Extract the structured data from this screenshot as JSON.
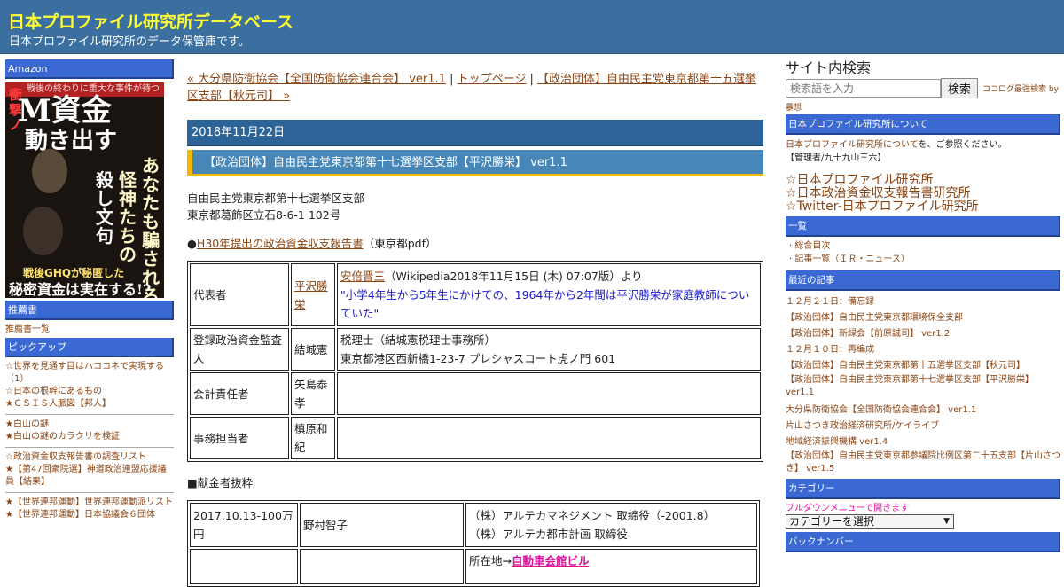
{
  "header": {
    "title": "日本プロファイル研究所データベース",
    "description": "日本プロファイル研究所のデータ保管庫です。"
  },
  "left_sidebar": {
    "amazon_label": "Amazon",
    "book": {
      "header": "戦後の終わりに重大な事件が待つ",
      "side": "衝撃ノ",
      "title_line1": "M資金",
      "title_line2": "動き出す",
      "vertical1": "あなたも騙される",
      "vertical2": "怪神たちの",
      "vertical3": "殺し文句",
      "bottom1": "戦後GHQが秘匿した",
      "bottom2": "秘密資金は実在する!?"
    },
    "recommend_label": "推薦書",
    "recommend_link": "推薦書一覧",
    "pickup_label": "ピックアップ",
    "pickup_groups": [
      [
        "☆世界を見通す目はハココネで実現する（1）",
        "☆日本の根幹にあるもの",
        "★ＣＳＩＳ人脈図【邦人】"
      ],
      [
        "★白山の謎",
        "★白山の謎のカラクリを検証"
      ],
      [
        "☆政治資金収支報告書の調査リスト",
        "★【第47回衆院選】神道政治連盟応援議員【結果】"
      ],
      [
        "★【世界連邦運動】世界連邦運動派リスト",
        "★【世界連邦運動】日本協議会６団体"
      ]
    ]
  },
  "main": {
    "nav": {
      "prev": "« 大分県防衛協会【全国防衛協会連合会】 ver1.1",
      "sep1": " | ",
      "top": "トップページ",
      "sep2": " | ",
      "next": "【政治団体】自由民主党東京都第十五選挙区支部【秋元司】 »"
    },
    "date": "2018年11月22日",
    "post_title": "【政治団体】自由民主党東京都第十七選挙区支部【平沢勝栄】 ver1.1",
    "org_name": "自由民主党東京都第十七選挙区支部",
    "org_address": "東京都葛飾区立石8-6-1 102号",
    "pdf_bullet": "●",
    "pdf_link": "H30年提出の政治資金収支報告書",
    "pdf_suffix": "（東京都pdf）",
    "officers": {
      "rep_label": "代表者",
      "rep_name": "平沢勝栄",
      "rep_wiki_link": "安倍晋三",
      "rep_wiki_suffix": "（Wikipedia2018年11月15日 (木) 07:07版）より",
      "rep_quote": "\"小学4年生から5年生にかけての、1964年から2年間は平沢勝栄が家庭教師についていた\"",
      "auditor_label": "登録政治資金監査人",
      "auditor_name": "結城憲",
      "auditor_office": "税理士（結城憲税理士事務所）",
      "auditor_address": "東京都港区西新橋1-23-7 プレシャスコート虎ノ門 601",
      "treasurer_label": "会計責任者",
      "treasurer_name": "矢島泰孝",
      "clerk_label": "事務担当者",
      "clerk_name": "槙原和紀"
    },
    "donors_heading": "■献金者抜粋",
    "donors": {
      "row1_date": "2017.10.13-100万円",
      "row1_name": "野村智子",
      "row1_role1": "（株）アルテカマネジメント 取締役（-2001.8）",
      "row1_role2": "（株）アルテカ都市計画 取締役",
      "row2_location_prefix": "所在地→",
      "row2_location_link": "自動車会館ビル"
    }
  },
  "right_sidebar": {
    "search_title": "サイト内検索",
    "search_placeholder": "検索語を入力",
    "search_button": "検索",
    "search_powered_1": "ココログ最強検索 by",
    "search_powered_2": "暴想",
    "about_label": "日本プロファイル研究所について",
    "about_link": "日本プロファイル研究所について",
    "about_suffix": "を、ご参照ください。",
    "admin": "【管理者/九十九山三六】",
    "big_links": [
      "☆日本プロファイル研究所",
      "☆日本政治資金収支報告書研究所",
      "☆Twitter-日本プロファイル研究所"
    ],
    "list_label": "一覧",
    "list_items": [
      "総合目次",
      "記事一覧（ＩＲ・ニュース）"
    ],
    "recent_label": "最近の記事",
    "recent_items": [
      "１２月２１日：備忘録",
      "【政治団体】自由民主党東京都環境保全支部",
      "【政治団体】新緑会【前原誠司】 ver1.2",
      "１２月１０日：再編成",
      "【政治団体】自由民主党東京都第十五選挙区支部【秋元司】",
      "【政治団体】自由民主党東京都第十七選挙区支部【平沢勝栄】 ver1.1",
      "大分県防衛協会【全国防衛協会連合会】 ver1.1",
      "片山さつき政治経済研究所/ケイライブ",
      "地域経済振興機構 ver1.4",
      "【政治団体】自由民主党東京都参議院比例区第二十五支部【片山さつき】 ver1.5"
    ],
    "category_label": "カテゴリー",
    "category_hint": "プルダウンメニューで開きます",
    "category_select": "カテゴリーを選択",
    "backnumber_label": "バックナンバー"
  }
}
